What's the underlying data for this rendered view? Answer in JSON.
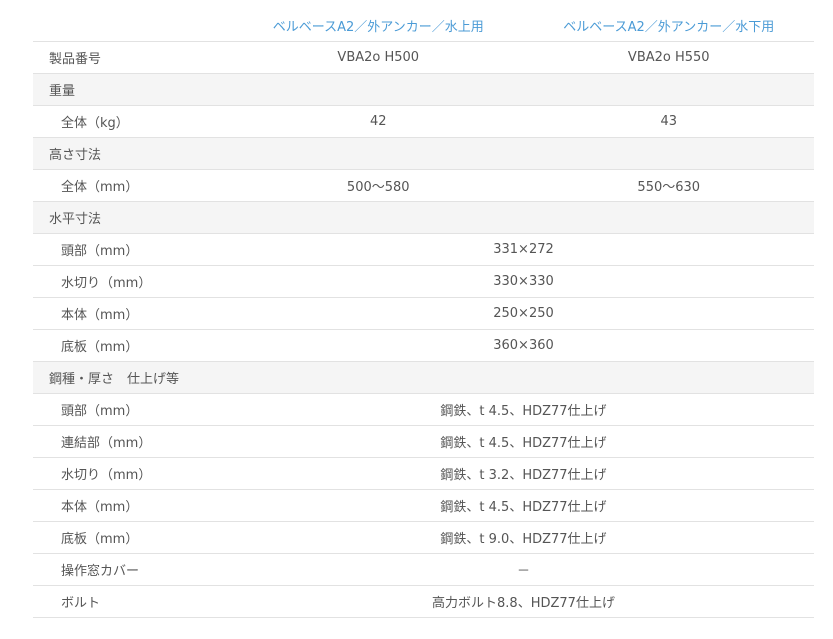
{
  "header": {
    "col1": "ベルベースA2／外アンカー／水上用",
    "col2": "ベルベースA2／外アンカー／水下用"
  },
  "rows": {
    "product": {
      "label": "製品番号",
      "v1": "VBA2o H500",
      "v2": "VBA2o H550"
    },
    "weight_section": {
      "label": "重量"
    },
    "weight_total": {
      "label": "全体（kg）",
      "v1": "42",
      "v2": "43"
    },
    "height_section": {
      "label": "高さ寸法"
    },
    "height_total": {
      "label": "全体（mm）",
      "v1": "500～580",
      "v2": "550～630"
    },
    "horiz_section": {
      "label": "水平寸法"
    },
    "horiz_head": {
      "label": "頭部（mm）",
      "v": "331×272"
    },
    "horiz_drip": {
      "label": "水切り（mm）",
      "v": "330×330"
    },
    "horiz_body": {
      "label": "本体（mm）",
      "v": "250×250"
    },
    "horiz_base": {
      "label": "底板（mm）",
      "v": "360×360"
    },
    "steel_section": {
      "label": "鋼種・厚さ　仕上げ等"
    },
    "steel_head": {
      "label": "頭部（mm）",
      "v": "鋼鉄、t 4.5、HDZ77仕上げ"
    },
    "steel_joint": {
      "label": "連結部（mm）",
      "v": "鋼鉄、t 4.5、HDZ77仕上げ"
    },
    "steel_drip": {
      "label": "水切り（mm）",
      "v": "鋼鉄、t 3.2、HDZ77仕上げ"
    },
    "steel_body": {
      "label": "本体（mm）",
      "v": "鋼鉄、t 4.5、HDZ77仕上げ"
    },
    "steel_base": {
      "label": "底板（mm）",
      "v": "鋼鉄、t 9.0、HDZ77仕上げ"
    },
    "cover": {
      "label": "操作窓カバー",
      "v": "－"
    },
    "bolt": {
      "label": "ボルト",
      "v": "高力ボルト8.8、HDZ77仕上げ"
    }
  },
  "colors": {
    "header_text": "#4b9bd6",
    "section_bg": "#f5f5f5",
    "border": "#e2e2e2"
  }
}
